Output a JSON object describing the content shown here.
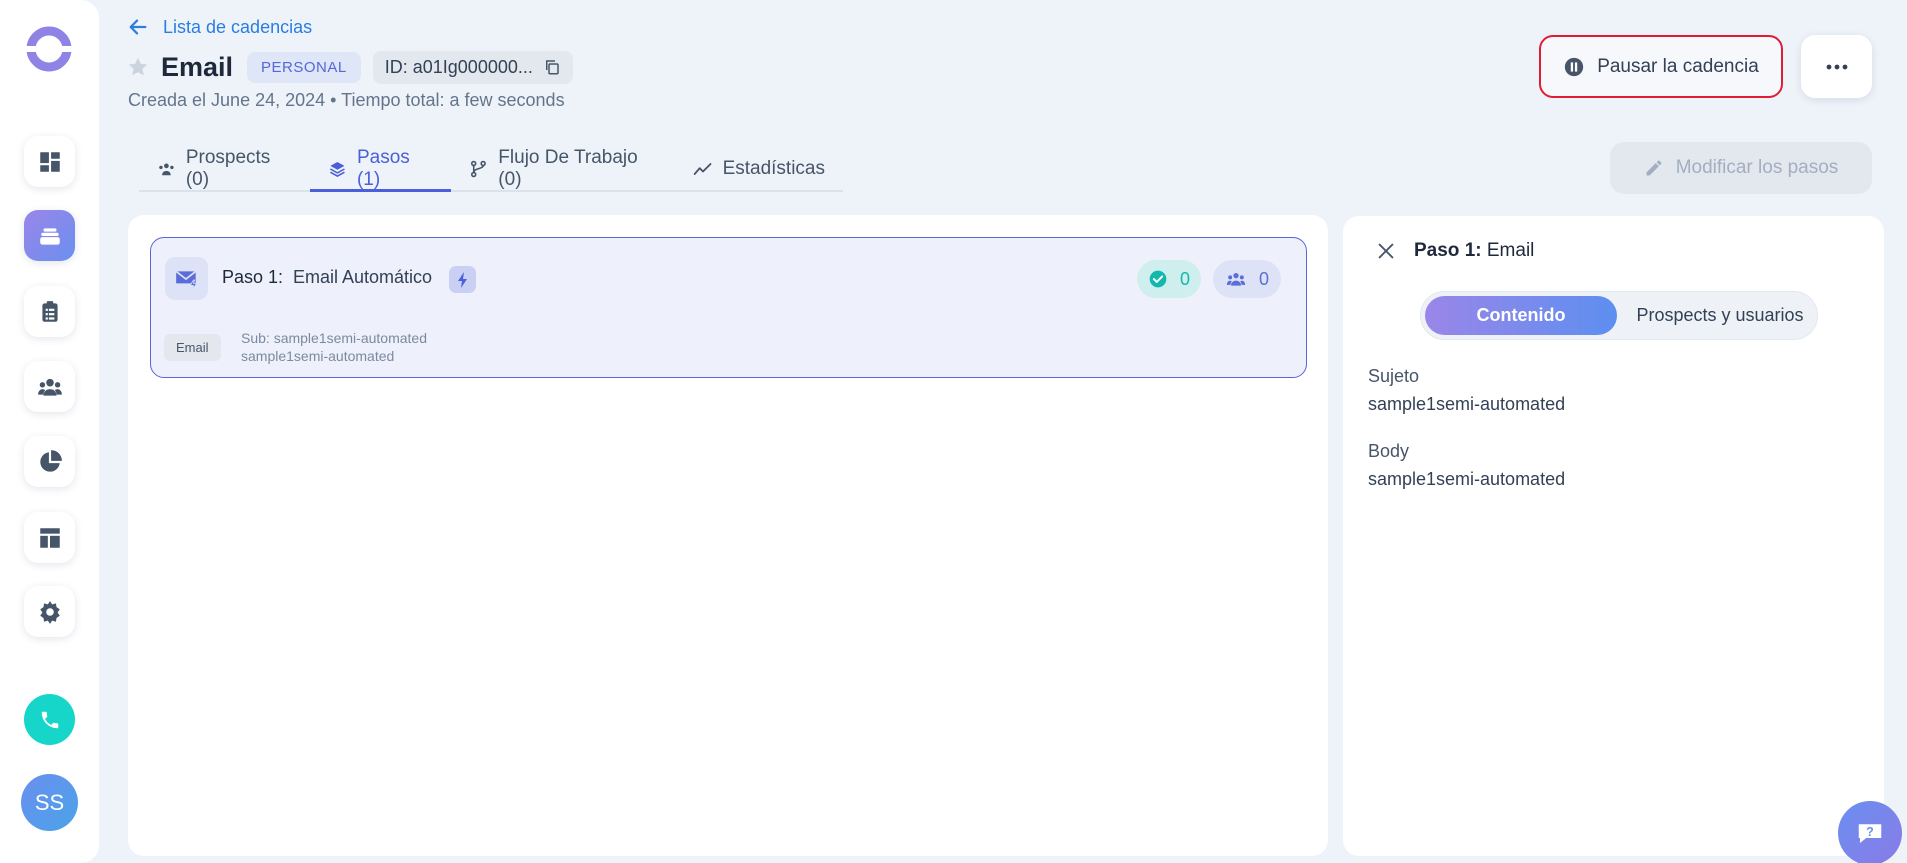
{
  "colors": {
    "accent": "#4a5fd8",
    "link": "#2a7de1",
    "danger_border": "#e11d36",
    "teal": "#16d5c9",
    "gradient_start": "#9a86e8",
    "gradient_end": "#5d8ff0"
  },
  "sidebar": {
    "logo_icon": "ring-logo-icon",
    "items": [
      {
        "icon": "dashboard-icon",
        "active": false
      },
      {
        "icon": "cadences-stack-icon",
        "active": true
      },
      {
        "icon": "clipboard-icon",
        "active": false
      },
      {
        "icon": "people-icon",
        "active": false
      },
      {
        "icon": "pie-chart-icon",
        "active": false
      },
      {
        "icon": "layout-icon",
        "active": false
      },
      {
        "icon": "gear-icon",
        "active": false
      }
    ],
    "phone_icon": "phone-icon",
    "avatar_initials": "SS"
  },
  "header": {
    "back_label": "Lista de cadencias",
    "title": "Email",
    "badge": "PERSONAL",
    "id_label": "ID:  a01Ig000000...",
    "subtitle": "Creada el June 24, 2024 • Tiempo total: a few seconds",
    "pause_label": "Pausar la cadencia",
    "more_icon": "ellipsis-icon"
  },
  "tabs": [
    {
      "label": "Prospects (0)",
      "icon": "people-icon",
      "active": false
    },
    {
      "label": "Pasos (1)",
      "icon": "layers-icon",
      "active": true
    },
    {
      "label": "Flujo De Trabajo (0)",
      "icon": "branch-icon",
      "active": false
    },
    {
      "label": "Estadísticas",
      "icon": "trend-icon",
      "active": false
    }
  ],
  "modify_label": "Modificar los pasos",
  "step": {
    "label": "Paso 1:",
    "name": "Email Automático",
    "completed_count": "0",
    "users_count": "0",
    "chip": "Email",
    "sub_line1": "Sub: sample1semi-automated",
    "sub_line2": "sample1semi-automated"
  },
  "detail": {
    "title_bold": "Paso 1:",
    "title_rest": "Email",
    "segment_active": "Contenido",
    "segment_inactive": "Prospects y usuarios",
    "subject_label": "Sujeto",
    "subject_value": "sample1semi-automated",
    "body_label": "Body",
    "body_value": "sample1semi-automated"
  },
  "help_icon": "question-icon"
}
